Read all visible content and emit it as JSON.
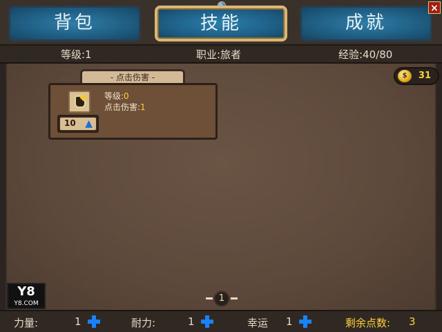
{
  "tabs": {
    "bag": "背包",
    "skills": "技能",
    "achievements": "成就"
  },
  "close_label": "×",
  "stats": {
    "level": "等级:1",
    "job": "职业:旅者",
    "exp": "经验:40/80"
  },
  "coins": {
    "icon_text": "$",
    "value": "31"
  },
  "skill": {
    "tab_title": "- 点击伤害 -",
    "level_label": "等级:",
    "level_value": "0",
    "damage_label": "点击伤害:",
    "damage_value": "1",
    "upgrade_cost": "10",
    "icon": "hand-click-icon"
  },
  "pagination": {
    "current": "1"
  },
  "logo": {
    "big": "Y8",
    "small": "Y8.COM"
  },
  "attributes": {
    "strength_label": "力量:",
    "strength_value": "1",
    "stamina_label": "耐力:",
    "stamina_value": "1",
    "luck_label": "幸运",
    "luck_value": "1",
    "remaining_label": "剩余点数:",
    "remaining_value": "3"
  },
  "colors": {
    "tab_blue": "#1f5d82",
    "gold_text": "#ffd23a",
    "plus_blue": "#1a82ff",
    "panel_brown": "#5d493b"
  }
}
